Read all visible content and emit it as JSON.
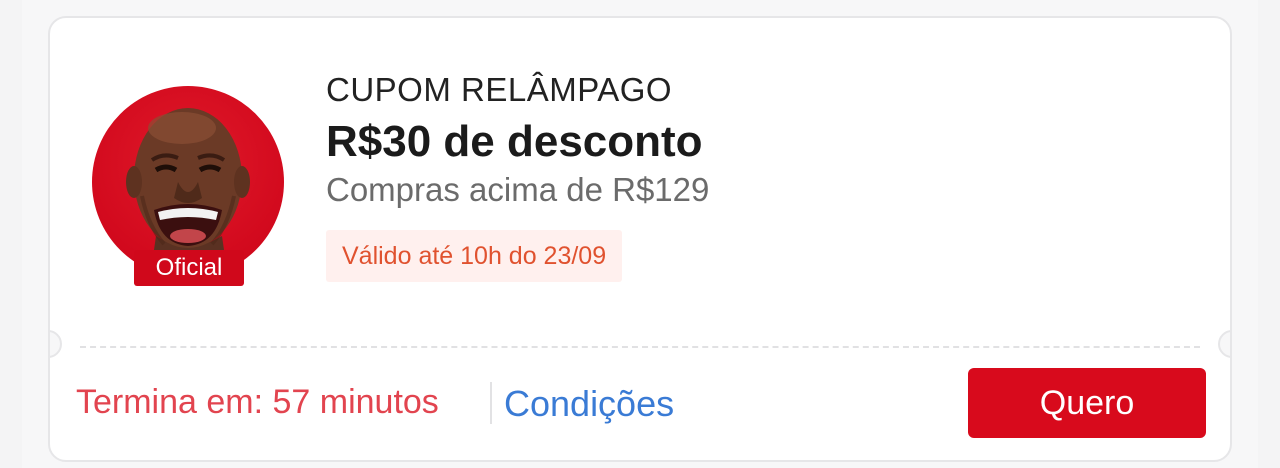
{
  "coupon": {
    "badge": {
      "label": "Oficial"
    },
    "type_label": "CUPOM RELÂMPAGO",
    "title": "R$30 de desconto",
    "condition": "Compras acima de R$129",
    "validity": "Válido até 10h do 23/09"
  },
  "footer": {
    "countdown": "Termina em: 57 minutos",
    "conditions_link": "Condições",
    "cta_label": "Quero"
  },
  "colors": {
    "brand_red": "#d80a1c",
    "link_blue": "#3a7bd5",
    "countdown_red": "#e2444f",
    "validity_orange": "#e0522f"
  }
}
